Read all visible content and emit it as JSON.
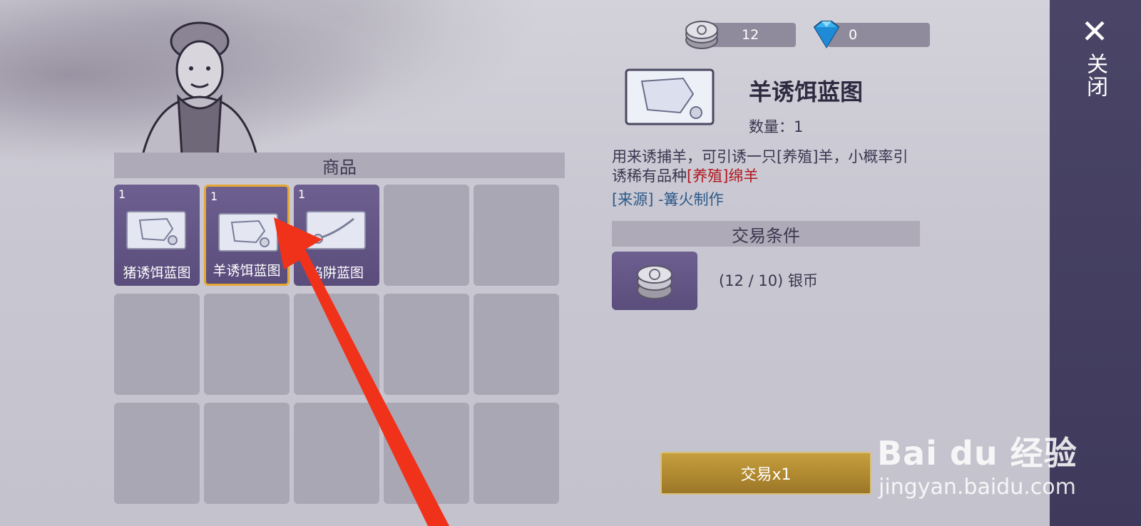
{
  "currency": {
    "silver": {
      "icon": "silver-coin-icon",
      "value": "12"
    },
    "diamond": {
      "icon": "diamond-icon",
      "value": "0"
    }
  },
  "close": {
    "label": "关闭",
    "icon": "close-icon"
  },
  "shop": {
    "header": "商品",
    "items": [
      {
        "count": "1",
        "name": "猪诱饵蓝图",
        "icon": "blueprint-icon"
      },
      {
        "count": "1",
        "name": "羊诱饵蓝图",
        "icon": "blueprint-icon",
        "selected": true
      },
      {
        "count": "1",
        "name": "陷阱蓝图",
        "icon": "trap-blueprint-icon"
      }
    ]
  },
  "detail": {
    "title": "羊诱饵蓝图",
    "quantity": "数量：1",
    "desc_main": "用来诱捕羊，可引诱一只[养殖]羊，小概率引诱稀有品种",
    "desc_highlight": "[养殖]绵羊",
    "source": "[来源] -篝火制作"
  },
  "trade": {
    "header": "交易条件",
    "requirement": "(12 / 10) 银币",
    "button": "交易x1"
  },
  "watermark": {
    "logo": "Bai du 经验",
    "url": "jingyan.baidu.com"
  },
  "colors": {
    "accent_gold": "#b08930",
    "slot_purple": "#5a4d7c",
    "highlight_red": "#b0171e",
    "source_blue": "#2b5a8a",
    "annotation_arrow": "#f0321b"
  }
}
